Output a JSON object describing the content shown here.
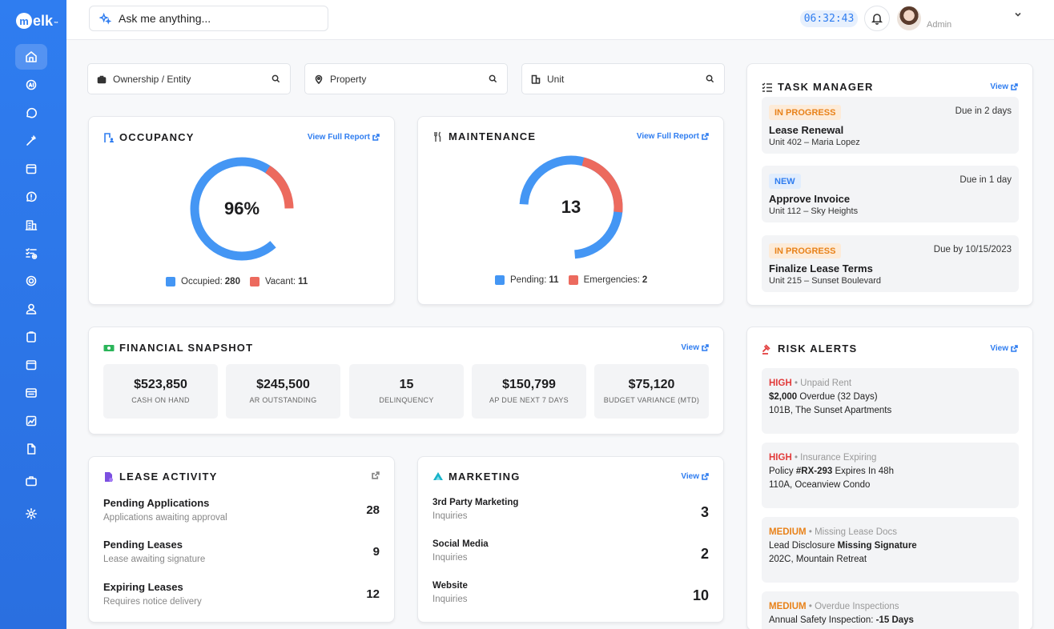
{
  "brand": {
    "logo_letter": "m",
    "logo_text": "elk",
    "logo_suffix": "™"
  },
  "topbar": {
    "ask_placeholder": "Ask me anything...",
    "clock": "06:32:43",
    "user_role": "Admin"
  },
  "filters": [
    {
      "label": "Ownership / Entity",
      "icon": "briefcase-icon"
    },
    {
      "label": "Property",
      "icon": "location-pin-icon"
    },
    {
      "label": "Unit",
      "icon": "building-icon"
    }
  ],
  "occupancy": {
    "title": "OCCUPANCY",
    "link": "View Full Report",
    "center": "96%",
    "legend": [
      {
        "label": "Occupied:",
        "value": "280",
        "color": "#4496f4"
      },
      {
        "label": "Vacant:",
        "value": "11",
        "color": "#ec6a5e"
      }
    ]
  },
  "maintenance": {
    "title": "MAINTENANCE",
    "link": "View Full Report",
    "center": "13",
    "legend": [
      {
        "label": "Pending:",
        "value": "11",
        "color": "#4496f4"
      },
      {
        "label": "Emergencies:",
        "value": "2",
        "color": "#ec6a5e"
      }
    ]
  },
  "financial": {
    "title": "FINANCIAL SNAPSHOT",
    "link": "View",
    "tiles": [
      {
        "value": "$523,850",
        "label": "CASH ON HAND"
      },
      {
        "value": "$245,500",
        "label": "AR OUTSTANDING"
      },
      {
        "value": "15",
        "label": "DELINQUENCY"
      },
      {
        "value": "$150,799",
        "label": "AP DUE NEXT 7 DAYS"
      },
      {
        "value": "$75,120",
        "label": "BUDGET VARIANCE (MTD)"
      }
    ]
  },
  "lease": {
    "title": "LEASE ACTIVITY",
    "rows": [
      {
        "title": "Pending Applications",
        "sub": "Applications awaiting approval",
        "count": "28"
      },
      {
        "title": "Pending Leases",
        "sub": "Lease awaiting signature",
        "count": "9"
      },
      {
        "title": "Expiring Leases",
        "sub": "Requires notice delivery",
        "count": "12"
      }
    ]
  },
  "marketing": {
    "title": "MARKETING",
    "link": "View",
    "rows": [
      {
        "title": "3rd Party Marketing",
        "sub": "Inquiries",
        "count": "3"
      },
      {
        "title": "Social Media",
        "sub": "Inquiries",
        "count": "2"
      },
      {
        "title": "Website",
        "sub": "Inquiries",
        "count": "10"
      }
    ]
  },
  "tasks": {
    "title": "TASK MANAGER",
    "link": "View",
    "items": [
      {
        "status": "IN PROGRESS",
        "due": "Due in 2 days",
        "title": "Lease Renewal",
        "sub": "Unit 402 – Maria Lopez"
      },
      {
        "status": "NEW",
        "due": "Due in 1 day",
        "title": "Approve Invoice",
        "sub": "Unit 112 – Sky Heights"
      },
      {
        "status": "IN PROGRESS",
        "due": "Due by 10/15/2023",
        "title": "Finalize Lease Terms",
        "sub": "Unit 215 – Sunset Boulevard"
      }
    ]
  },
  "risk": {
    "title": "RISK ALERTS",
    "link": "View",
    "items": [
      {
        "level": "HIGH",
        "sep": " • ",
        "category": "Unpaid Rent",
        "line1_bold": "$2,000",
        "line1_rest": " Overdue (32 Days)",
        "line2": "101B, The Sunset Apartments"
      },
      {
        "level": "HIGH",
        "sep": " • ",
        "category": "Insurance Expiring",
        "line1_pre": "Policy ",
        "line1_bold": "#RX-293",
        "line1_rest": " Expires In 48h",
        "line2": "110A, Oceanview Condo"
      },
      {
        "level": "MEDIUM",
        "sep": " • ",
        "category": "Missing Lease Docs",
        "line1_pre": "Lead Disclosure ",
        "line1_bold": "Missing Signature",
        "line2": "202C, Mountain Retreat"
      },
      {
        "level": "MEDIUM",
        "sep": " • ",
        "category": "Overdue Inspections",
        "line1_pre": "Annual Safety Inspection: ",
        "line1_bold": "-15 Days"
      }
    ]
  },
  "colors": {
    "accent": "#2f7df0",
    "pending": "#4496f4",
    "alert": "#ec6a5e",
    "high": "#e23b3b",
    "medium": "#e8821a"
  }
}
